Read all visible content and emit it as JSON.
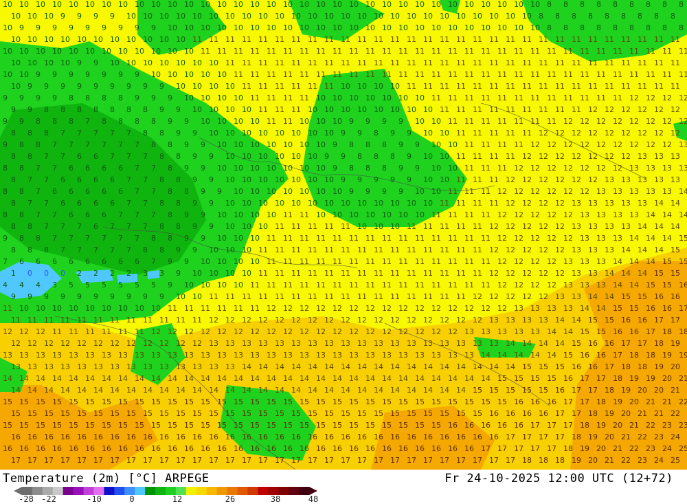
{
  "header": {
    "title_left": "Temperature (2m) [°C] ARPEGE",
    "title_right": "Fr 24-10-2025 12:00 UTC (12+72)"
  },
  "legend": {
    "tick_labels": [
      "-28",
      "-22",
      "-10",
      "0",
      "12",
      "26",
      "38",
      "48"
    ],
    "tick_values": [
      -28,
      -22,
      -10,
      0,
      12,
      26,
      38,
      48
    ],
    "min": -28,
    "max": 48,
    "colors": [
      "#6e6e6e",
      "#8c8c8c",
      "#aaaaaa",
      "#c8c8c8",
      "#7a0090",
      "#9a10b8",
      "#c040d8",
      "#e070f0",
      "#1010c8",
      "#2050f0",
      "#3c90ff",
      "#50c8ff",
      "#009600",
      "#10b410",
      "#20d020",
      "#50e050",
      "#f0f000",
      "#f8d800",
      "#f8b800",
      "#f09800",
      "#e87800",
      "#e05800",
      "#d03800",
      "#c00000",
      "#a00000",
      "#800000",
      "#600010",
      "#400010"
    ]
  },
  "map": {
    "label_colors": {
      "cold": "#2a55ff",
      "green": "#0b5a0b",
      "yellow": "#5a4a00",
      "warm": "#5a2a00"
    },
    "zone_colors": {
      "green": "#1ed21e",
      "green_dark": "#0fb40f",
      "cyan": "#50c8ff",
      "yellow": "#f8f800",
      "orange": "#f8d000",
      "orange_deep": "#f4a800"
    }
  }
}
